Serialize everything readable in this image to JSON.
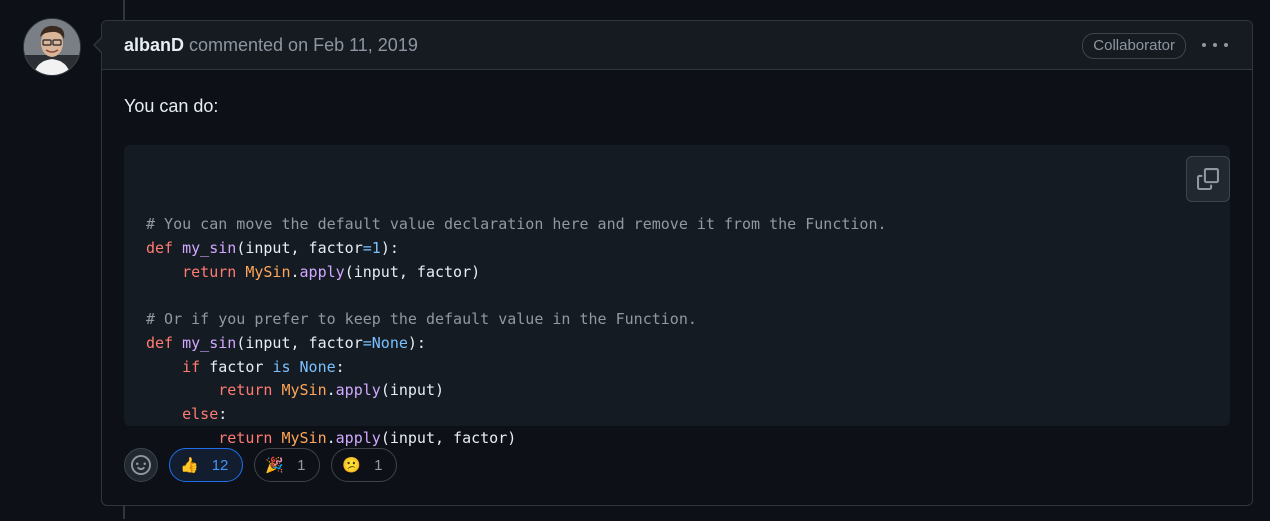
{
  "comment": {
    "author": "albanD",
    "action": "commented on",
    "date": "Feb 11, 2019",
    "badge": "Collaborator",
    "body_text": "You can do:"
  },
  "code_lines": [
    [
      {
        "t": "# You can move the default value declaration here and remove it from the Function.",
        "c": "c"
      }
    ],
    [
      {
        "t": "def",
        "c": "k"
      },
      {
        "t": " "
      },
      {
        "t": "my_sin",
        "c": "f"
      },
      {
        "t": "(input, factor"
      },
      {
        "t": "=",
        "c": "n"
      },
      {
        "t": "1",
        "c": "n"
      },
      {
        "t": "):"
      }
    ],
    [
      {
        "t": "    "
      },
      {
        "t": "return",
        "c": "k"
      },
      {
        "t": " "
      },
      {
        "t": "MySin",
        "c": "cl"
      },
      {
        "t": "."
      },
      {
        "t": "apply",
        "c": "f"
      },
      {
        "t": "(input, factor)"
      }
    ],
    [
      {
        "t": ""
      }
    ],
    [
      {
        "t": "# Or if you prefer to keep the default value in the Function.",
        "c": "c"
      }
    ],
    [
      {
        "t": "def",
        "c": "k"
      },
      {
        "t": " "
      },
      {
        "t": "my_sin",
        "c": "f"
      },
      {
        "t": "(input, factor"
      },
      {
        "t": "=",
        "c": "n"
      },
      {
        "t": "None",
        "c": "n"
      },
      {
        "t": "):"
      }
    ],
    [
      {
        "t": "    "
      },
      {
        "t": "if",
        "c": "k"
      },
      {
        "t": " factor "
      },
      {
        "t": "is",
        "c": "n"
      },
      {
        "t": " "
      },
      {
        "t": "None",
        "c": "n"
      },
      {
        "t": ":"
      }
    ],
    [
      {
        "t": "        "
      },
      {
        "t": "return",
        "c": "k"
      },
      {
        "t": " "
      },
      {
        "t": "MySin",
        "c": "cl"
      },
      {
        "t": "."
      },
      {
        "t": "apply",
        "c": "f"
      },
      {
        "t": "(input)"
      }
    ],
    [
      {
        "t": "    "
      },
      {
        "t": "else",
        "c": "k"
      },
      {
        "t": ":"
      }
    ],
    [
      {
        "t": "        "
      },
      {
        "t": "return",
        "c": "k"
      },
      {
        "t": " "
      },
      {
        "t": "MySin",
        "c": "cl"
      },
      {
        "t": "."
      },
      {
        "t": "apply",
        "c": "f"
      },
      {
        "t": "(input, factor)"
      }
    ]
  ],
  "reactions": [
    {
      "emoji": "👍",
      "count": "12",
      "active": true,
      "name": "thumbs-up"
    },
    {
      "emoji": "🎉",
      "count": "1",
      "active": false,
      "name": "hooray"
    },
    {
      "emoji": "😕",
      "count": "1",
      "active": false,
      "name": "confused"
    }
  ],
  "icons": {
    "copy": "copy-icon",
    "smiley": "smiley-icon",
    "more": "kebab-horizontal-icon"
  },
  "colors": {
    "background": "#0d1117",
    "header": "#161b22",
    "border": "#30363d",
    "code_bg": "#151b23",
    "active_reaction": "#1f6feb"
  }
}
